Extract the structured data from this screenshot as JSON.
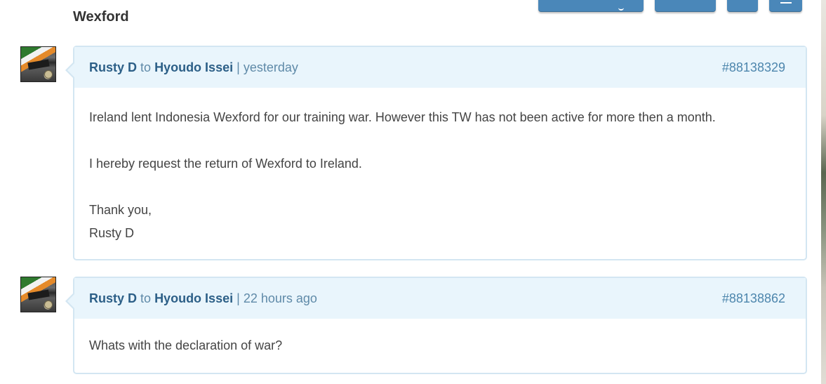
{
  "thread": {
    "title": "Wexford"
  },
  "posts": [
    {
      "author": "Rusty D",
      "to_word": "to",
      "recipient": "Hyoudo Issei",
      "separator": "|",
      "time": "yesterday",
      "post_id": "#88138329",
      "lines": [
        "Ireland lent Indonesia Wexford for our training war. However this TW has not been active for more then a month.",
        "I hereby request the return of Wexford to Ireland.",
        "Thank you,",
        "Rusty D"
      ]
    },
    {
      "author": "Rusty D",
      "to_word": "to",
      "recipient": "Hyoudo Issei",
      "separator": "|",
      "time": "22 hours ago",
      "post_id": "#88138862",
      "lines": [
        "Whats with the declaration of war?"
      ]
    }
  ],
  "colors": {
    "header_bg": "#e9f5fc",
    "border": "#d3e6f2",
    "link": "#2c5f87",
    "meta": "#5f8aa8",
    "button": "#4a87b9"
  }
}
